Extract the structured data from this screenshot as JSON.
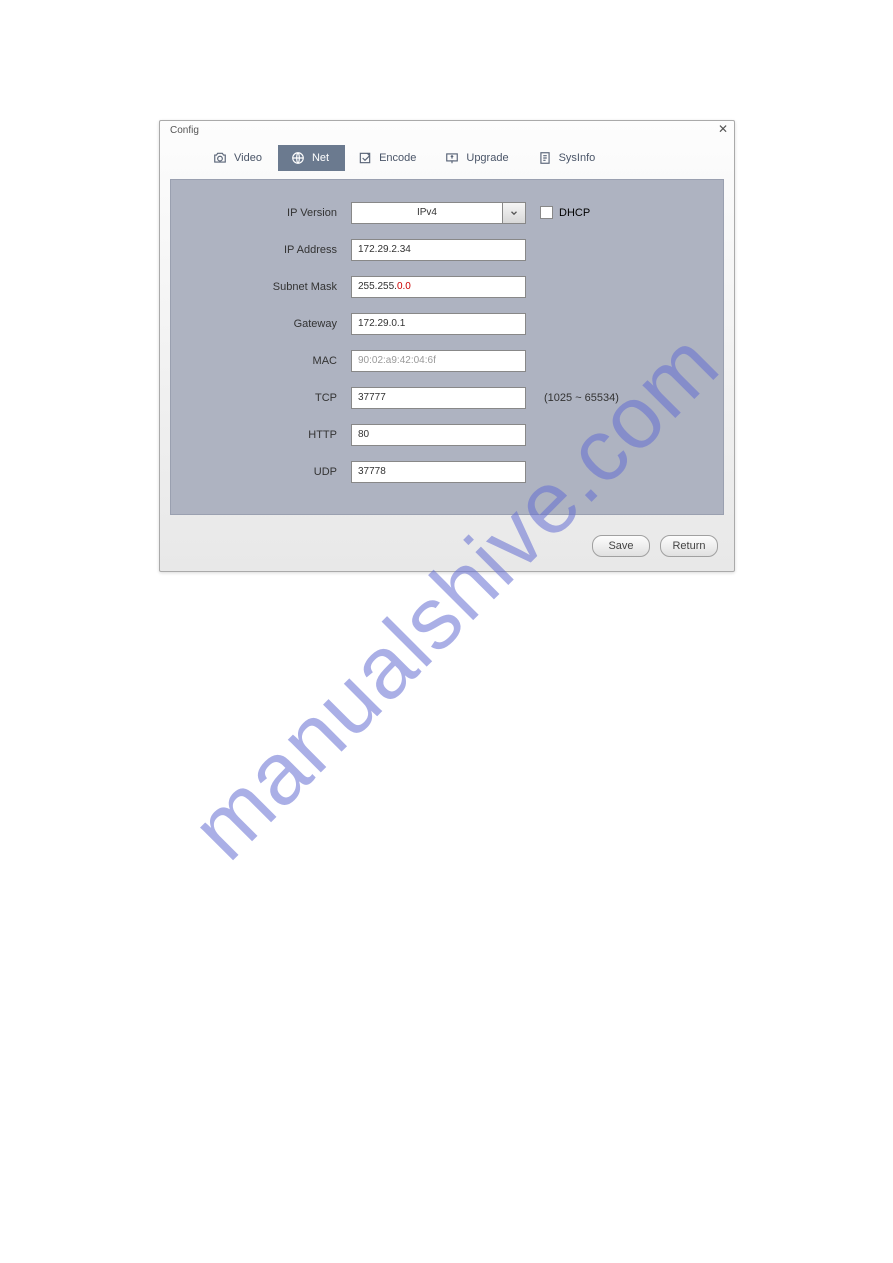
{
  "window": {
    "title": "Config"
  },
  "tabs": [
    {
      "label": "Video",
      "icon": "camera-icon"
    },
    {
      "label": "Net",
      "icon": "globe-icon",
      "active": true
    },
    {
      "label": "Encode",
      "icon": "encode-icon"
    },
    {
      "label": "Upgrade",
      "icon": "upgrade-icon"
    },
    {
      "label": "SysInfo",
      "icon": "sysinfo-icon"
    }
  ],
  "form": {
    "ip_version": {
      "label": "IP Version",
      "value": "IPv4"
    },
    "dhcp": {
      "label": "DHCP",
      "checked": false
    },
    "ip_address": {
      "label": "IP Address",
      "value": "172.29.2.34"
    },
    "subnet_mask": {
      "label": "Subnet Mask",
      "value_black": "255.255.",
      "value_red": "0.0"
    },
    "gateway": {
      "label": "Gateway",
      "value": "172.29.0.1"
    },
    "mac": {
      "label": "MAC",
      "value": "90:02:a9:42:04:6f"
    },
    "tcp": {
      "label": "TCP",
      "value": "37777",
      "hint": "(1025 ~ 65534)"
    },
    "http": {
      "label": "HTTP",
      "value": "80"
    },
    "udp": {
      "label": "UDP",
      "value": "37778"
    }
  },
  "buttons": {
    "save": "Save",
    "return": "Return"
  },
  "watermark": "manualshive.com"
}
